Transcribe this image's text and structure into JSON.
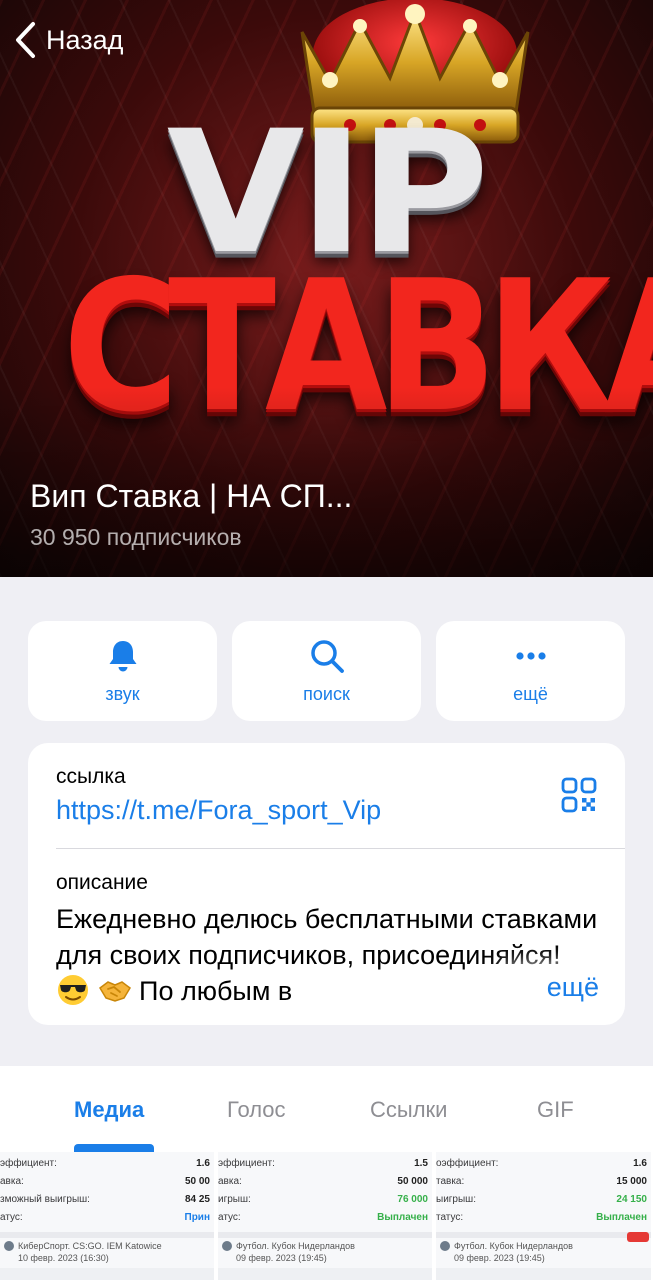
{
  "header": {
    "back_label": "Назад",
    "cover_logo": {
      "line1": "VIP",
      "line2": "СТАВКА"
    },
    "channel_title": "Вип Ставка | НА СП...",
    "subscribers": "30 950 подписчиков"
  },
  "actions": [
    {
      "icon": "bell-icon",
      "label": "звук"
    },
    {
      "icon": "search-icon",
      "label": "поиск"
    },
    {
      "icon": "more-icon",
      "label": "ещё"
    }
  ],
  "info": {
    "link_label": "ссылка",
    "link_value": "https://t.me/Fora_sport_Vip",
    "description_label": "описание",
    "description_part1": "Ежедневно делюсь бесплатными ставками для своих подписчиков, присоединяйся!",
    "description_part2": "По любым в",
    "more_label": "ещё"
  },
  "tabs": [
    {
      "label": "Медиа",
      "active": true
    },
    {
      "label": "Голос",
      "active": false
    },
    {
      "label": "Ссылки",
      "active": false
    },
    {
      "label": "GIF",
      "active": false
    }
  ],
  "media": [
    {
      "rows": [
        {
          "k": "эффициент:",
          "v": "1.6"
        },
        {
          "k": "авка:",
          "v": "50 00"
        },
        {
          "k": "зможный выигрыш:",
          "v": "84 25"
        },
        {
          "k": "атус:",
          "v": "Прин"
        }
      ],
      "event": "КиберСпорт. CS:GO. IEM Katowice",
      "date": "10 февр. 2023 (16:30)"
    },
    {
      "rows": [
        {
          "k": "эффициент:",
          "v": "1.5"
        },
        {
          "k": "авка:",
          "v": "50 000"
        },
        {
          "k": "игрыш:",
          "v": "76 000"
        },
        {
          "k": "атус:",
          "v": "Выплачен"
        }
      ],
      "event": "Футбол. Кубок Нидерландов",
      "date": "09 февр. 2023 (19:45)"
    },
    {
      "rows": [
        {
          "k": "оэффициент:",
          "v": "1.6"
        },
        {
          "k": "тавка:",
          "v": "15 000"
        },
        {
          "k": "ыигрыш:",
          "v": "24 150"
        },
        {
          "k": "татус:",
          "v": "Выплачен"
        }
      ],
      "event": "Футбол. Кубок Нидерландов",
      "date": "09 февр. 2023 (19:45)"
    }
  ],
  "colors": {
    "accent": "#1a7ee8",
    "logo_red": "#f2261e",
    "paid_green": "#36b04a"
  }
}
